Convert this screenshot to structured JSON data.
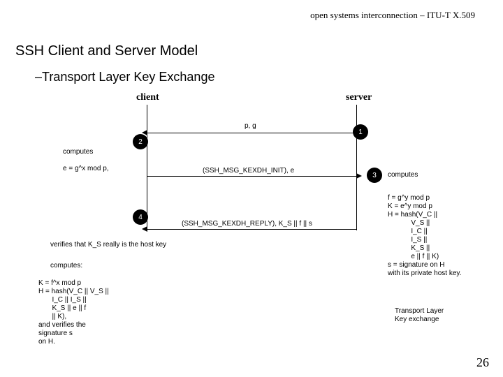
{
  "header": {
    "right": "open systems interconnection – ITU-T X.509"
  },
  "title": "SSH Client and Server Model",
  "dash": "–",
  "subtitle": "Transport Layer Key Exchange",
  "labels": {
    "client": "client",
    "server": "server"
  },
  "messages": {
    "m1": "p, g",
    "m2": "(SSH_MSG_KEXDH_INIT), e",
    "m3": "(SSH_MSG_KEXDH_REPLY), K_S || f || s"
  },
  "steps": {
    "s1": "1",
    "s2": "2",
    "s3": "3",
    "s4": "4"
  },
  "notes": {
    "client_compute_e": "computes\n\ne = g^x mod p,",
    "server_computes_label": "computes",
    "server_block": "f = g^y mod p\nK = e^y mod p\nH = hash(V_C ||\n            V_S ||\n            I_C ||\n            I_S ||\n            K_S ||\n            e || f || K)\ns = signature on H\nwith its private host key.",
    "client_verify": "verifies that K_S really is the host key",
    "client_computes_label": "computes:",
    "client_block": "K = f^x mod p\nH = hash(V_C || V_S ||\n       I_C || I_S ||\n       K_S || e || f\n       || K),\nand verifies the\nsignature s\non H.",
    "caption": "Transport Layer\nKey exchange"
  },
  "pagenum": "26"
}
